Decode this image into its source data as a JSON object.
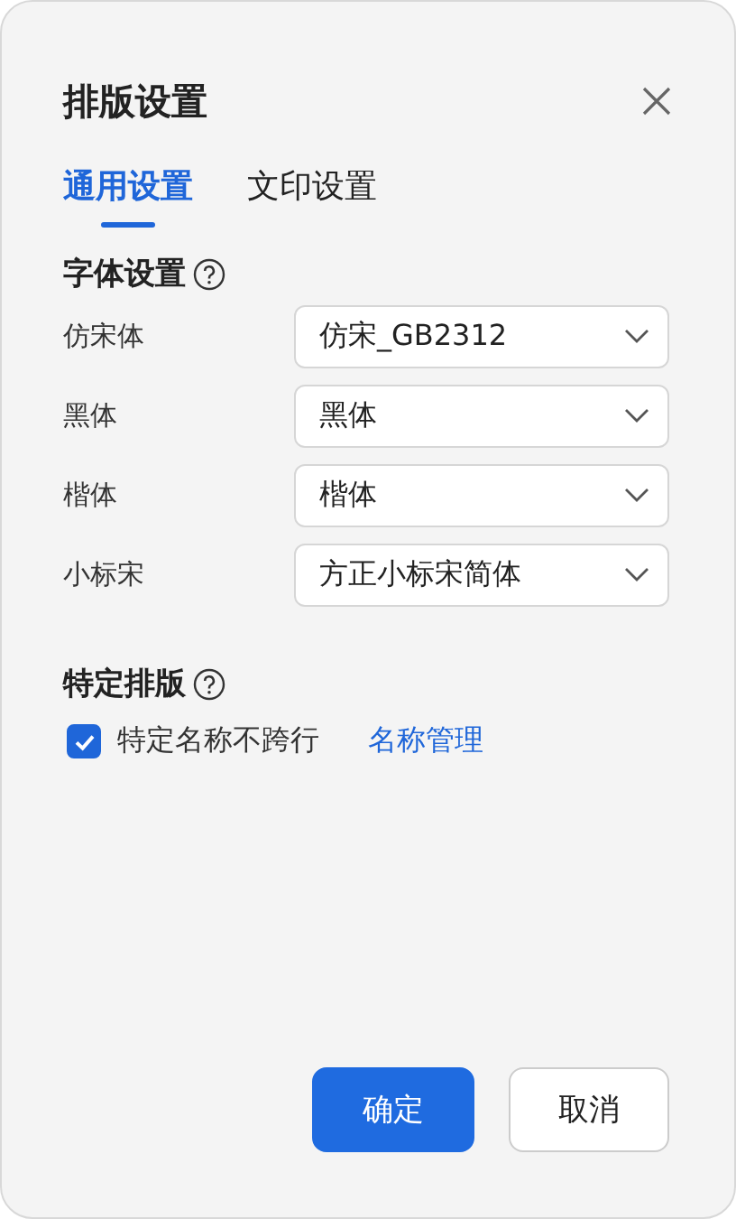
{
  "dialog": {
    "title": "排版设置"
  },
  "tabs": [
    {
      "label": "通用设置",
      "selected": true
    },
    {
      "label": "文印设置",
      "selected": false
    }
  ],
  "font_section": {
    "heading": "字体设置",
    "rows": [
      {
        "label": "仿宋体",
        "value": "仿宋_GB2312"
      },
      {
        "label": "黑体",
        "value": "黑体"
      },
      {
        "label": "楷体",
        "value": "楷体"
      },
      {
        "label": "小标宋",
        "value": "方正小标宋简体"
      }
    ]
  },
  "layout_section": {
    "heading": "特定排版",
    "checkbox": {
      "label": "特定名称不跨行",
      "checked": true
    },
    "link": "名称管理"
  },
  "buttons": [
    {
      "label": "确定",
      "kind": "primary"
    },
    {
      "label": "取消",
      "kind": "secondary"
    }
  ]
}
